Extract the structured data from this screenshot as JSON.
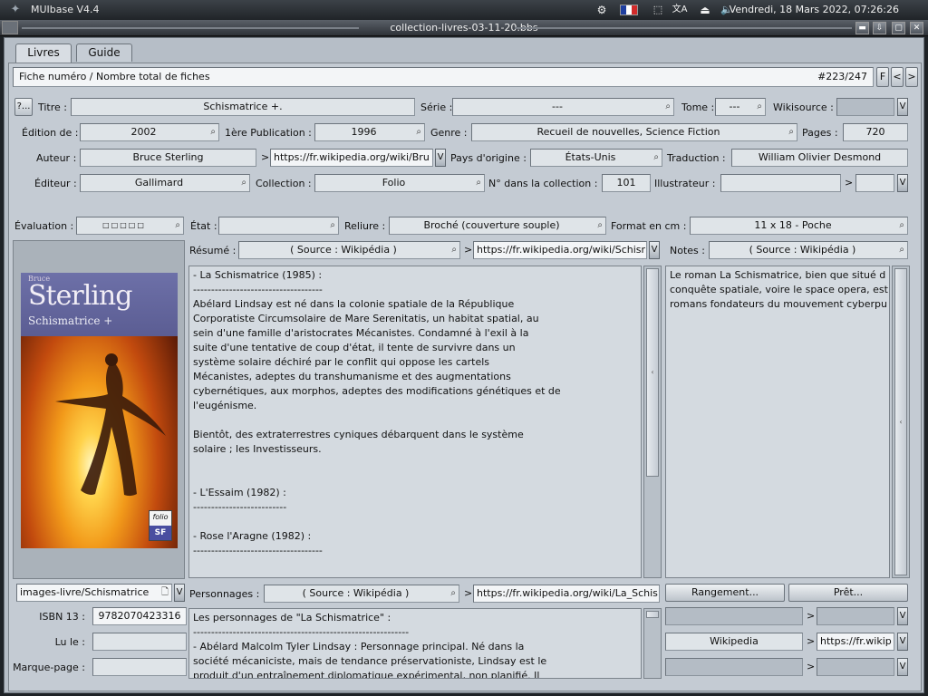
{
  "system": {
    "app_name": "MUIbase V4.4",
    "clock": "Vendredi, 18 Mars 2022, 07:26:26",
    "icons": [
      "settings-icon",
      "flag-fr-icon",
      "screenshot-icon",
      "translate-icon",
      "eject-icon",
      "volume-icon"
    ]
  },
  "window": {
    "title": "collection-livres-03-11-20.bbs"
  },
  "tabs": [
    "Livres",
    "Guide"
  ],
  "record_bar": {
    "label": "Fiche numéro / Nombre total de fiches",
    "count": "#223/247",
    "filter_btn": "F",
    "prev_btn": "<",
    "next_btn": ">"
  },
  "fields": {
    "help_btn": "?...",
    "titre_label": "Titre :",
    "titre": "Schismatrice +.",
    "serie_label": "Série :",
    "serie": "---",
    "tome_label": "Tome :",
    "tome": "---",
    "wikisource_label": "Wikisource :",
    "wikisource": "",
    "edition_label": "Édition de :",
    "edition": "2002",
    "premiere_label": "1ère Publication :",
    "premiere": "1996",
    "genre_label": "Genre :",
    "genre": "Recueil de nouvelles, Science Fiction",
    "pages_label": "Pages :",
    "pages": "720",
    "auteur_label": "Auteur :",
    "auteur": "Bruce Sterling",
    "auteur_url": "https://fr.wikipedia.org/wiki/Bru",
    "pays_label": "Pays d'origine :",
    "pays": "États-Unis",
    "traduction_label": "Traduction :",
    "traduction": "William Olivier Desmond",
    "editeur_label": "Éditeur :",
    "editeur": "Gallimard",
    "collection_label": "Collection :",
    "collection": "Folio",
    "num_collection_label": "N° dans la collection :",
    "num_collection": "101",
    "illustrateur_label": "Illustrateur :",
    "illustrateur": "",
    "evaluation_label": "Évaluation :",
    "evaluation": "□□□□□",
    "etat_label": "État :",
    "etat": "",
    "reliure_label": "Reliure :",
    "reliure": "Broché (couverture souple)",
    "format_label": "Format en cm :",
    "format": "11 x 18 - Poche",
    "v_btn": "V",
    "arrow": ">"
  },
  "cover": {
    "author_small": "Bruce",
    "author": "Sterling",
    "title": "Schismatrice +",
    "folio": "folio",
    "sf": "SF",
    "image_path": "images-livre/Schismatrice"
  },
  "resume": {
    "label": "Résumé :",
    "source": "( Source : Wikipédia )",
    "url": "https://fr.wikipedia.org/wiki/Schisr",
    "lines": [
      "- La Schismatrice (1985) :",
      "------------------------------------",
      "Abélard Lindsay est né dans la colonie spatiale de la République",
      "Corporatiste Circumsolaire de Mare Serenitatis, un habitat spatial, au",
      "sein d'une famille d'aristocrates Mécanistes. Condamné à l'exil à la",
      "suite d'une tentative de coup d'état, il tente de survivre dans un",
      "système solaire déchiré par le conflit qui oppose les cartels",
      "Mécanistes, adeptes du transhumanisme et des augmentations",
      "cybernétiques, aux morphos, adeptes des modifications génétiques et de",
      "l'eugénisme.",
      "",
      "Bientôt, des extraterrestres cyniques débarquent dans le système",
      "solaire ; les Investisseurs.",
      "",
      "",
      "- L'Essaim (1982) :",
      "--------------------------",
      "",
      "- Rose l'Aragne (1982) :",
      "------------------------------------"
    ]
  },
  "notes": {
    "label": "Notes :",
    "source": "( Source : Wikipédia )",
    "lines": [
      "Le roman La Schismatrice, bien que situé d",
      "conquête spatiale, voire le space opera, est",
      "romans fondateurs du mouvement cyberpu"
    ]
  },
  "personnages": {
    "label": "Personnages :",
    "source": "( Source : Wikipédia )",
    "url": "https://fr.wikipedia.org/wiki/La_Schis",
    "lines": [
      "Les personnages de \"La Schismatrice\" :",
      "------------------------------------------------------------",
      "- Abélard Malcolm Tyler Lindsay : Personnage principal. Né dans la",
      "société mécaniciste, mais de tendance préservationiste, Lindsay est le",
      "produit d'un entraînement diplomatique expérimental, non planifié. Il"
    ]
  },
  "bottom_left": {
    "isbn_label": "ISBN 13 :",
    "isbn": "9782070423316",
    "lule_label": "Lu le :",
    "lule": "",
    "marque_label": "Marque-page :",
    "marque": ""
  },
  "right_buttons": {
    "rangement": "Rangement...",
    "pret": "Prêt..."
  },
  "links": [
    {
      "name": "",
      "url": ""
    },
    {
      "name": "Wikipedia",
      "url": "https://fr.wikip"
    },
    {
      "name": "",
      "url": ""
    }
  ]
}
